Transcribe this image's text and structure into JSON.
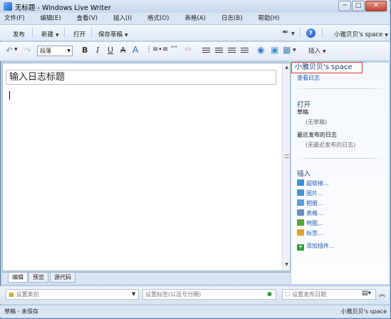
{
  "window": {
    "title": "无标题 - Windows Live Writer",
    "minimize_glyph": "─",
    "maximize_glyph": "□",
    "close_glyph": "✕"
  },
  "menu": [
    "文件(F)",
    "编辑(E)",
    "查看(V)",
    "插入(I)",
    "格式(O)",
    "表格(A)",
    "日志(B)",
    "帮助(H)"
  ],
  "commands": {
    "publish": "发布",
    "new": "新建",
    "open": "打开",
    "save_draft": "保存草稿",
    "blog_account": "小雅贝贝's space"
  },
  "format_toolbar": {
    "style_value": "段落",
    "bold": "B",
    "italic": "I",
    "underline": "U",
    "strike": "A",
    "font_color": "A",
    "quote": "“”",
    "insert_menu": "插入"
  },
  "editor": {
    "title_placeholder": "输入日志标题"
  },
  "view_tabs": [
    "编辑",
    "预览",
    "源代码"
  ],
  "sidebar": {
    "blog_name": "小雅贝贝's space",
    "view_blog": "查看日志",
    "open_heading": "打开",
    "drafts_label": "草稿",
    "drafts_empty": "(无草稿)",
    "recent_label": "最近发布的日志",
    "recent_empty": "(无最近发布的日志)",
    "insert_heading": "插入",
    "insert_items": [
      {
        "label": "超链接...",
        "icon": "hyperlink-icon",
        "color": "#3a8fd8"
      },
      {
        "label": "图片...",
        "icon": "picture-icon",
        "color": "#4a90c8"
      },
      {
        "label": "相册...",
        "icon": "album-icon",
        "color": "#5b9bd5"
      },
      {
        "label": "表格...",
        "icon": "table-icon",
        "color": "#6a8fb8"
      },
      {
        "label": "地图...",
        "icon": "map-icon",
        "color": "#58a640"
      },
      {
        "label": "标签...",
        "icon": "tag-icon",
        "color": "#e0a030"
      },
      {
        "label": "添加插件...",
        "icon": "add-plugin-icon",
        "color": "#2e9e3e"
      }
    ]
  },
  "properties": {
    "category_placeholder": "设置类别",
    "tags_placeholder": "设置标签(以逗号分隔)",
    "date_placeholder": "设置发布日期"
  },
  "status": {
    "left": "草稿 - 未保存",
    "right": "小雅贝贝's space"
  }
}
